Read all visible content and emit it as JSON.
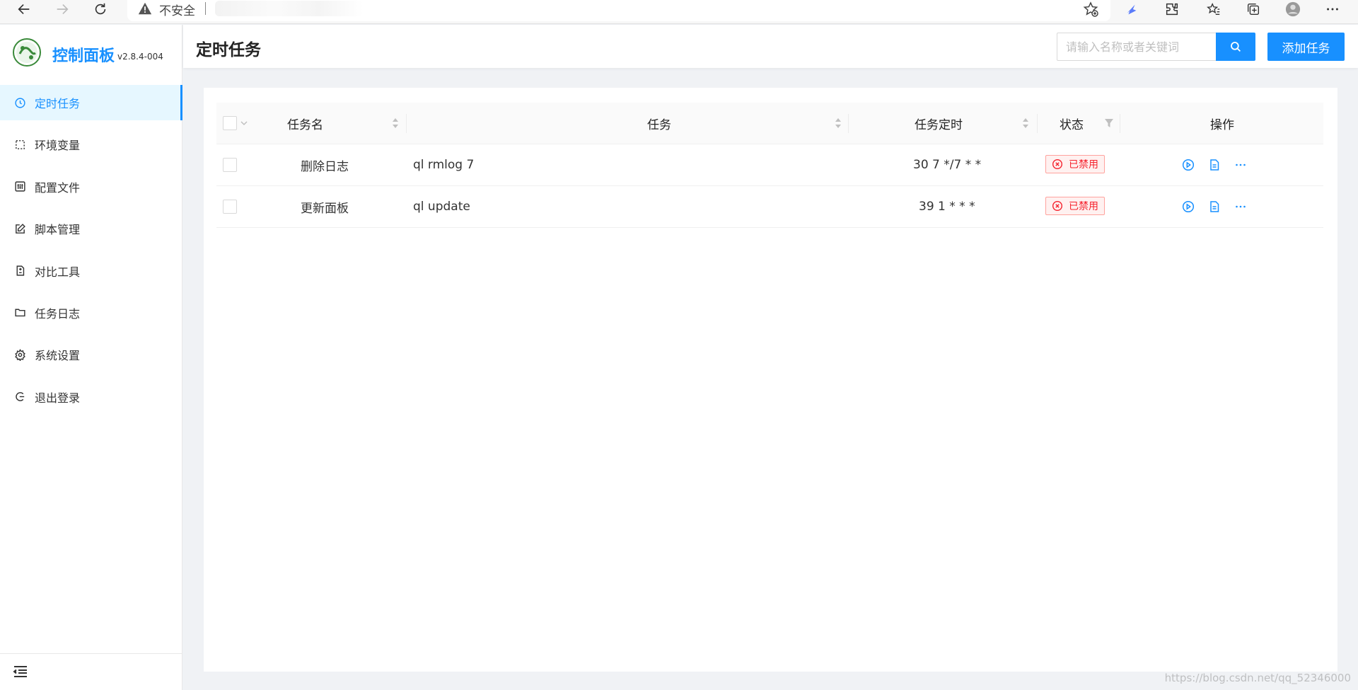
{
  "browser": {
    "security_label": "不安全",
    "icons": [
      "back-icon",
      "forward-icon",
      "refresh-icon",
      "warning-icon",
      "add-favorite-icon",
      "extension-icon",
      "puzzle-icon",
      "favorites-icon",
      "collections-icon",
      "profile-icon",
      "more-icon"
    ]
  },
  "app": {
    "title": "控制面板",
    "version": "v2.8.4-004",
    "accent_color": "#1890ff"
  },
  "sidebar": {
    "items": [
      {
        "label": "定时任务",
        "icon": "clock-icon",
        "active": true
      },
      {
        "label": "环境变量",
        "icon": "dashed-square-icon",
        "active": false
      },
      {
        "label": "配置文件",
        "icon": "sliders-icon",
        "active": false
      },
      {
        "label": "脚本管理",
        "icon": "edit-icon",
        "active": false
      },
      {
        "label": "对比工具",
        "icon": "diff-icon",
        "active": false
      },
      {
        "label": "任务日志",
        "icon": "folder-icon",
        "active": false
      },
      {
        "label": "系统设置",
        "icon": "gear-icon",
        "active": false
      },
      {
        "label": "退出登录",
        "icon": "logout-icon",
        "active": false
      }
    ]
  },
  "header": {
    "title": "定时任务",
    "search_placeholder": "请输入名称或者关键词",
    "add_label": "添加任务"
  },
  "table": {
    "columns": [
      "任务名",
      "任务",
      "任务定时",
      "状态",
      "操作"
    ],
    "rows": [
      {
        "name": "删除日志",
        "command": "ql rmlog 7",
        "schedule": "30 7 */7 * *",
        "status": "已禁用"
      },
      {
        "name": "更新面板",
        "command": "ql update",
        "schedule": "39 1 * * *",
        "status": "已禁用"
      }
    ]
  },
  "watermark": "https://blog.csdn.net/qq_52346000"
}
